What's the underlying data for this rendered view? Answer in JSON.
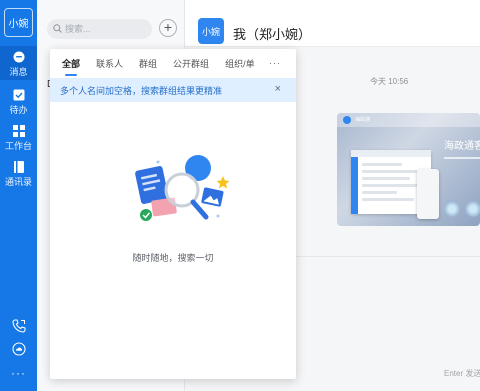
{
  "rail": {
    "logo": "小婉",
    "items": [
      {
        "key": "messages",
        "label": "消息",
        "icon": "chat-bubble-icon"
      },
      {
        "key": "todo",
        "label": "待办",
        "icon": "checkbox-icon"
      },
      {
        "key": "workbench",
        "label": "工作台",
        "icon": "grid-icon"
      },
      {
        "key": "contacts",
        "label": "通讯录",
        "icon": "book-icon"
      }
    ],
    "bottom_icons": [
      "phone-icon",
      "cloud-icon",
      "more-icon"
    ],
    "more_glyph": "···"
  },
  "conversation_list": {
    "search_placeholder": "搜索...",
    "add_label": "+",
    "peek_item": "D"
  },
  "chat": {
    "avatar": "小婉",
    "title": "我（郑小婉）",
    "timestamp": "今天 10:56",
    "card": {
      "slogan": "海政通客户",
      "header_text": "海政通"
    },
    "input_hint": "Enter 发送"
  },
  "search_popup": {
    "tabs": [
      "全部",
      "联系人",
      "群组",
      "公开群组",
      "组织/单位"
    ],
    "active_tab": 0,
    "more": "···",
    "notice": "多个人名间加空格，搜索群组结果更精准",
    "close": "×",
    "empty_text": "随时随地，搜索一切"
  },
  "colors": {
    "brand": "#1677e6",
    "accent": "#2f86f0",
    "notice_bg": "#dfefff"
  }
}
